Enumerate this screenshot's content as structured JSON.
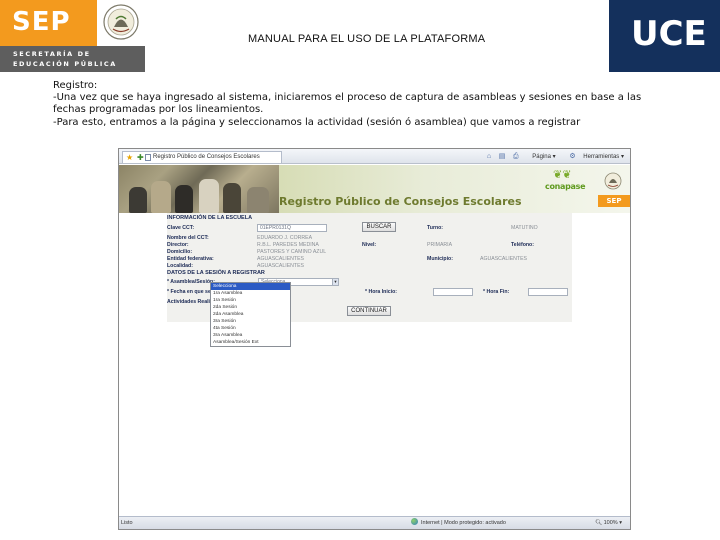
{
  "header": {
    "brand": "SEP",
    "brand_sub_line1": "SECRETARÍA DE",
    "brand_sub_line2": "EDUCACIÓN PÚBLICA",
    "title": "MANUAL PARA EL USO DE LA PLATAFORMA",
    "org": "UCE"
  },
  "body": {
    "line1": "Registro:",
    "line2": "-Una vez que se haya ingresado al sistema, iniciaremos el proceso de captura de asambleas y sesiones en base a las",
    "line3": "fechas programadas por los lineamientos.",
    "line4": "-Para esto, entramos a la página y seleccionamos la actividad (sesión ó asamblea) que vamos a registrar"
  },
  "browser": {
    "tab_title": "Registro Público de Consejos Escolares",
    "toolbar": {
      "page_label": "Página",
      "tools_label": "Herramientas"
    },
    "banner": {
      "title": "Registro Público de Consejos Escolares",
      "brand": "conapase",
      "sep": "SEP"
    },
    "form": {
      "section1": "INFORMACIÓN DE LA ESCUELA",
      "cct_label": "Clave CCT:",
      "cct_value": "01EPR0131Q",
      "search_button": "BUSCAR",
      "turno_label": "Turno:",
      "turno_value": "MATUTINO",
      "nombre_label": "Nombre del CCT:",
      "nombre_value": "EDUARDO J. CORREA",
      "director_label": "Director:",
      "director_value": "R.B.L. PAREDES MEDINA",
      "nivel_label": "Nivel:",
      "nivel_value": "PRIMARIA",
      "telefono_label": "Teléfono:",
      "domicilio_label": "Domicilio:",
      "domicilio_value": "PASTORES Y CAMINO AZUL",
      "entidad_label": "Entidad federativa:",
      "entidad_value": "AGUASCALIENTES",
      "municipio_label": "Municipio:",
      "municipio_value": "AGUASCALIENTES",
      "localidad_label": "Localidad:",
      "localidad_value": "AGUASCALIENTES",
      "section2": "DATOS DE LA SESIÓN A REGISTRAR",
      "asamblea_label": "* Asamblea/Sesión:",
      "asamblea_selected": "Selecciona",
      "fecha_label": "* Fecha en que se celebra:",
      "hora_inicio_label": "* Hora Inicio:",
      "hora_fin_label": "* Hora Fin:",
      "actividades_label": "Actividades Realizadas:",
      "continue_button": "CONTINUAR"
    },
    "dropdown_options": [
      "Selecciona",
      "1ra Asamblea",
      "1ra Sesión",
      "2da Sesión",
      "2da Asamblea",
      "3ra Sesión",
      "4ta Sesión",
      "3ra Asamblea",
      "Asamblea/Sesión Ext"
    ],
    "status": {
      "left": "Listo",
      "zone": "Internet | Modo protegido: activado",
      "zoom": "100%"
    }
  },
  "colors": {
    "sep_orange": "#f39a1e",
    "uce_navy": "#14305c",
    "form_label": "#1c2a55",
    "selection_blue": "#2c5bc4"
  }
}
